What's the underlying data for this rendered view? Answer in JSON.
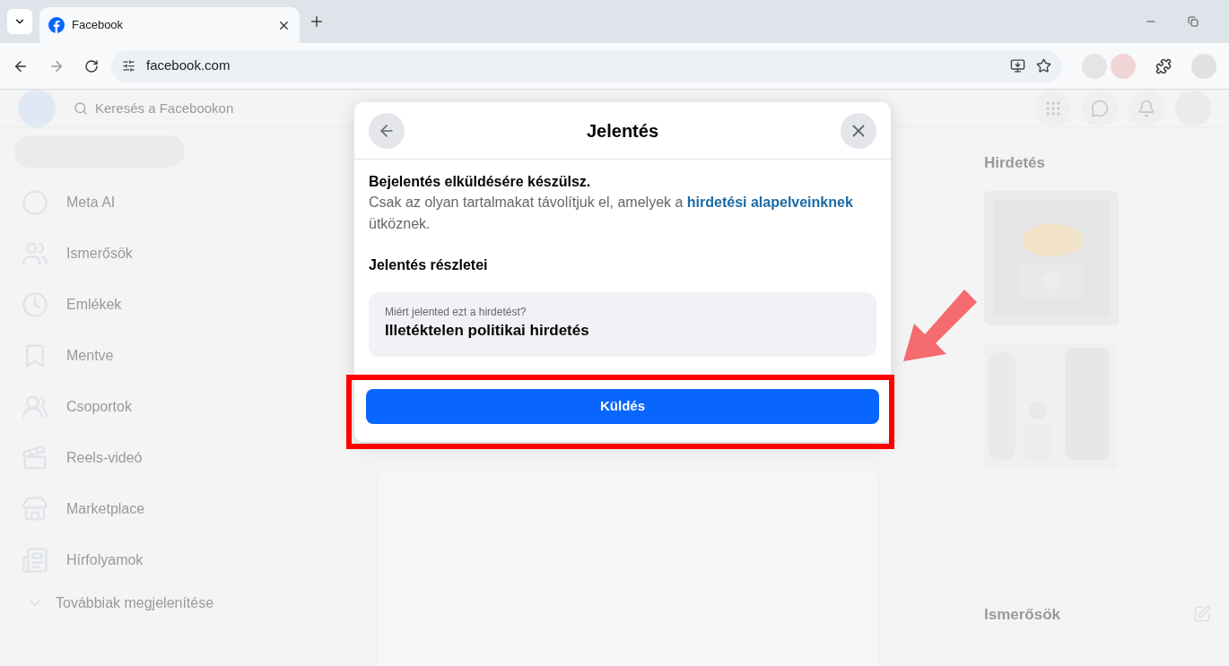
{
  "browser": {
    "tab": {
      "title": "Facebook"
    },
    "address": "facebook.com"
  },
  "page": {
    "search": {
      "placeholder": "Keresés a Facebookon"
    },
    "sidebar": {
      "items": [
        {
          "label": "Meta AI"
        },
        {
          "label": "Ismerősök"
        },
        {
          "label": "Emlékek"
        },
        {
          "label": "Mentve"
        },
        {
          "label": "Csoportok"
        },
        {
          "label": "Reels-videó"
        },
        {
          "label": "Marketplace"
        },
        {
          "label": "Hírfolyamok"
        }
      ],
      "more": "Továbbiak megjelenítése"
    },
    "right_column": {
      "ads_heading": "Hirdetés",
      "contacts_heading": "Ismerősök"
    }
  },
  "dialog": {
    "title": "Jelentés",
    "intro_heading": "Bejelentés elküldésére készülsz.",
    "intro_text": "Csak az olyan tartalmakat távolítjuk el, amelyek a",
    "link": "hirdetési alapelveinknek",
    "intro_tail": "ütköznek.",
    "details_heading": "Jelentés részletei",
    "reason": {
      "label": "Miért jelented ezt a hirdetést?",
      "value": "Illetéktelen politikai hirdetés"
    },
    "submit": "Küldés"
  },
  "annotation": {
    "highlight": true,
    "arrow": true
  }
}
